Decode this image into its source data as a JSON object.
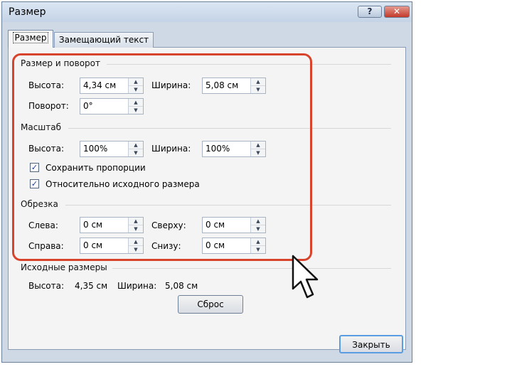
{
  "window": {
    "title": "Размер",
    "help_glyph": "?",
    "close_glyph": "✕"
  },
  "tabs": [
    {
      "label": "Размер",
      "active": true
    },
    {
      "label": "Замещающий текст",
      "active": false
    }
  ],
  "size_rotation": {
    "heading": "Размер и поворот",
    "height_label": "Высота:",
    "height_value": "4,34 см",
    "width_label": "Ширина:",
    "width_value": "5,08 см",
    "rotation_label": "Поворот:",
    "rotation_value": "0°"
  },
  "scale": {
    "heading": "Масштаб",
    "height_label": "Высота:",
    "height_value": "100%",
    "width_label": "Ширина:",
    "width_value": "100%",
    "lock_aspect_label": "Сохранить пропорции",
    "lock_aspect_checked": true,
    "relative_original_label": "Относительно исходного размера",
    "relative_original_checked": true
  },
  "crop": {
    "heading": "Обрезка",
    "left_label": "Слева:",
    "left_value": "0 см",
    "top_label": "Сверху:",
    "top_value": "0 см",
    "right_label": "Справа:",
    "right_value": "0 см",
    "bottom_label": "Снизу:",
    "bottom_value": "0 см"
  },
  "original_size": {
    "heading": "Исходные размеры",
    "height_label": "Высота:",
    "height_value": "4,35 см",
    "width_label": "Ширина:",
    "width_value": "5,08 см",
    "reset_label": "Сброс"
  },
  "footer": {
    "close_label": "Закрыть"
  },
  "icons": {
    "spin_up": "▲",
    "spin_down": "▼",
    "check": "✓"
  },
  "colors": {
    "highlight": "#d8432b",
    "titlebar": "#c4d3e6",
    "default_button_border": "#5b9de3"
  }
}
